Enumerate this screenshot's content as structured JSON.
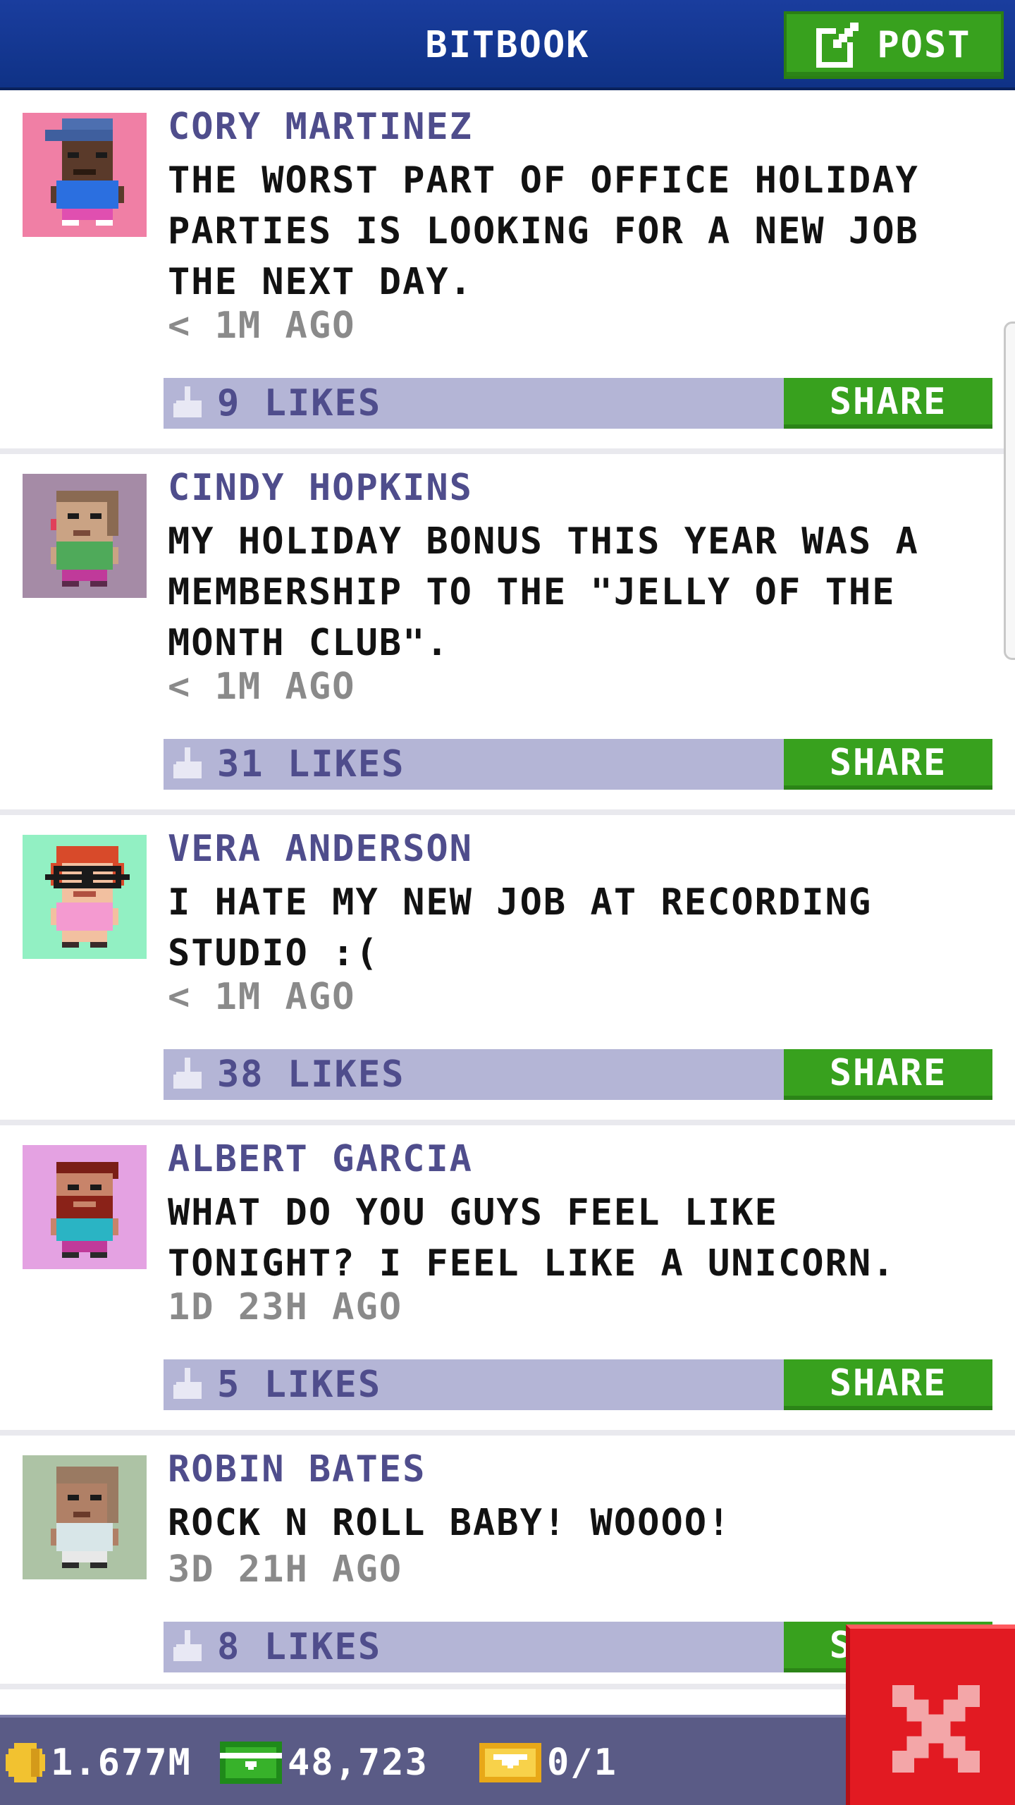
{
  "header": {
    "title": "BITBOOK",
    "post_label": "POST"
  },
  "posts": [
    {
      "author": "CORY MARTINEZ",
      "lines": [
        "THE WORST PART OF OFFICE HOLIDAY",
        "PARTIES IS LOOKING FOR A NEW JOB",
        "THE NEXT DAY."
      ],
      "time": "< 1M AGO",
      "likes": "9 LIKES",
      "share": "SHARE",
      "avatar_bg": "#f07fa5"
    },
    {
      "author": "CINDY HOPKINS",
      "lines": [
        "MY HOLIDAY BONUS THIS YEAR WAS A",
        "MEMBERSHIP TO THE \"JELLY OF THE",
        "MONTH CLUB\"."
      ],
      "time": "< 1M AGO",
      "likes": "31 LIKES",
      "share": "SHARE",
      "avatar_bg": "#a58ba6"
    },
    {
      "author": "VERA ANDERSON",
      "lines": [
        "I HATE MY NEW JOB AT RECORDING",
        "STUDIO :("
      ],
      "time": "< 1M AGO",
      "likes": "38 LIKES",
      "share": "SHARE",
      "avatar_bg": "#92f0c3"
    },
    {
      "author": "ALBERT GARCIA",
      "lines": [
        "WHAT DO YOU GUYS FEEL LIKE",
        "TONIGHT? I FEEL LIKE A UNICORN."
      ],
      "time": "1D 23H AGO",
      "likes": "5 LIKES",
      "share": "SHARE",
      "avatar_bg": "#e4a2e2"
    },
    {
      "author": "ROBIN BATES",
      "lines": [
        "ROCK N ROLL BABY! WOOOO!"
      ],
      "time": "3D 21H AGO",
      "likes": "8 LIKES",
      "share": "SHARE",
      "avatar_bg": "#adc3a5"
    }
  ],
  "bottom": {
    "coins": "1.677M",
    "bux": "48,723",
    "tickets": "0/1"
  },
  "colors": {
    "header": "#1a3d9e",
    "accent_green": "#38a11e",
    "like_bar": "#b4b5d6",
    "author": "#4f4d8c",
    "close": "#e21a22"
  }
}
